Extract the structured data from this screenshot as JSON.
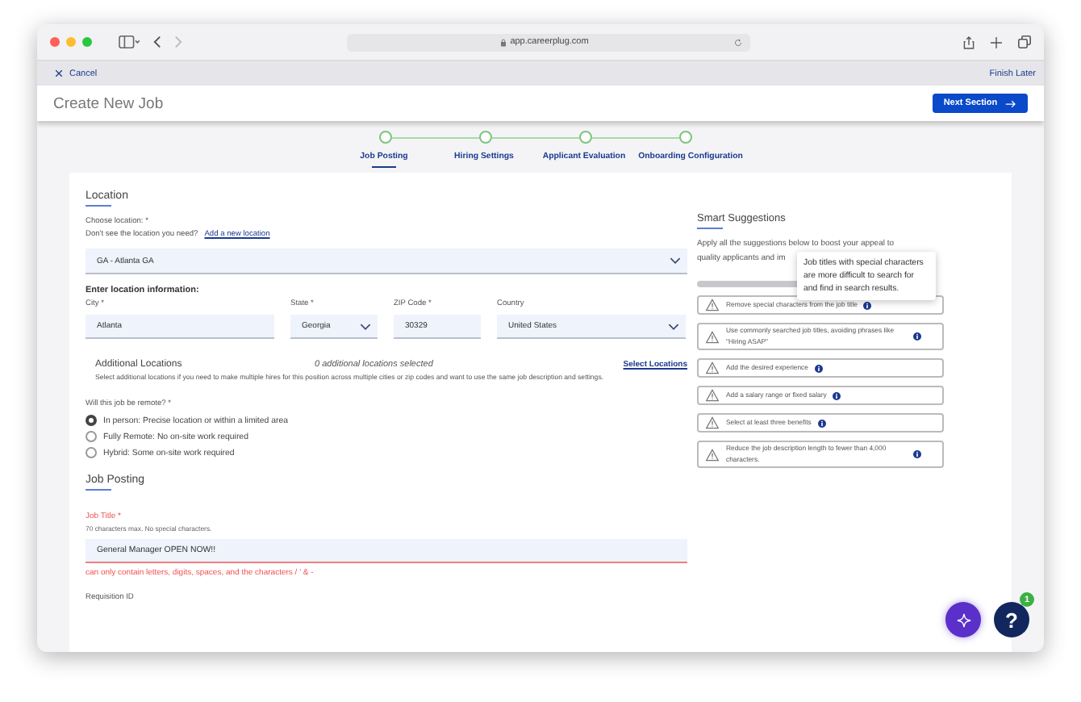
{
  "browser": {
    "url": "app.careerplug.com"
  },
  "topbar": {
    "cancel": "Cancel",
    "finish_later": "Finish Later"
  },
  "header": {
    "title": "Create New Job",
    "next_button": "Next Section"
  },
  "steps": [
    {
      "label": "Job Posting",
      "selected": true
    },
    {
      "label": "Hiring Settings",
      "selected": false
    },
    {
      "label": "Applicant Evaluation",
      "selected": false
    },
    {
      "label": "Onboarding Configuration",
      "selected": false
    }
  ],
  "location": {
    "heading": "Location",
    "choose_label": "Choose location: *",
    "prompt": "Don't see the location you need?",
    "link": "Add a new location",
    "selected_location": "GA - Atlanta GA",
    "info_heading": "Enter location information:",
    "fields": [
      {
        "label": "City *",
        "value": "Atlanta",
        "kind": "text"
      },
      {
        "label": "State *",
        "value": "Georgia",
        "kind": "select"
      },
      {
        "label": "ZIP Code *",
        "value": "30329",
        "kind": "text"
      },
      {
        "label": "Country",
        "value": "United States",
        "kind": "select"
      }
    ],
    "additional": {
      "title": "Additional Locations",
      "count": "0 additional locations selected",
      "link": "Select Locations",
      "description": "Select additional locations if you need to make multiple hires for this position across multiple cities or zip codes and want to use the same job description and settings."
    },
    "remote_question": "Will this job be remote? *",
    "remote_options": [
      {
        "label": "In person: Precise location or within a limited area",
        "selected": true
      },
      {
        "label": "Fully Remote: No on-site work required",
        "selected": false
      },
      {
        "label": "Hybrid: Some on-site work required",
        "selected": false
      }
    ]
  },
  "job_posting": {
    "heading": "Job Posting",
    "title_label": "Job Title *",
    "title_hint": "70 characters max. No special characters.",
    "title_value": "General Manager OPEN NOW!!",
    "title_error": "can only contain letters, digits, spaces, and the characters / ' & -",
    "requisition_label": "Requisition ID"
  },
  "suggestions": {
    "heading": "Smart Suggestions",
    "description_lines": [
      "Apply all the suggestions below to boost your appeal to",
      "quality applicants and im"
    ],
    "progress": {
      "level": 0
    },
    "tooltip": "Job titles with special characters are more difficult to search for and find in search results.",
    "items": [
      {
        "text": "Remove special characters from the job title"
      },
      {
        "text": "Use commonly searched job titles, avoiding phrases like \"Hiring ASAP\""
      },
      {
        "text": "Add the desired experience"
      },
      {
        "text": "Add a salary range or fixed salary"
      },
      {
        "text": "Select at least three benefits"
      },
      {
        "text": "Reduce the job description length to fewer than 4,000 characters."
      }
    ]
  },
  "help": {
    "label": "?",
    "badge": "1"
  }
}
